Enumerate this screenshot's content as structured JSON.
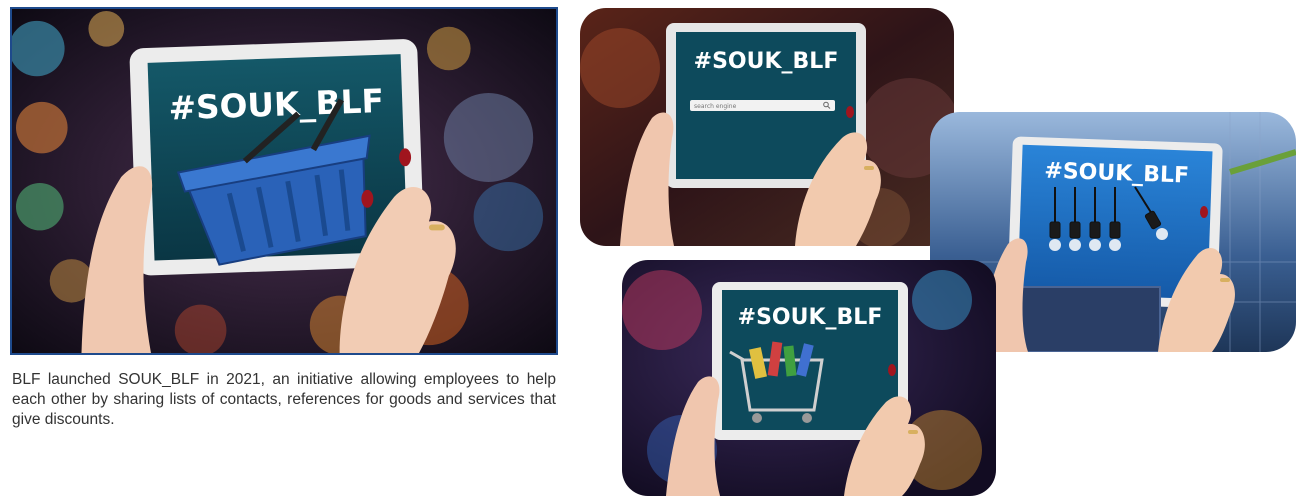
{
  "hashtag": "#SOUK_BLF",
  "search_placeholder": "search engine",
  "caption": "BLF launched SOUK_BLF in 2021, an initiative allowing employees to help each other by sharing lists of contacts, references for goods and services that give discounts.",
  "colors": {
    "frame_border": "#1e4a8c",
    "screen_teal": "#0d4a5c",
    "screen_blue": "#1f6fc7",
    "caption_text": "#333333"
  },
  "icons": [
    "basket-icon",
    "search-icon",
    "light-bulb-icon",
    "shopping-cart-icon"
  ]
}
